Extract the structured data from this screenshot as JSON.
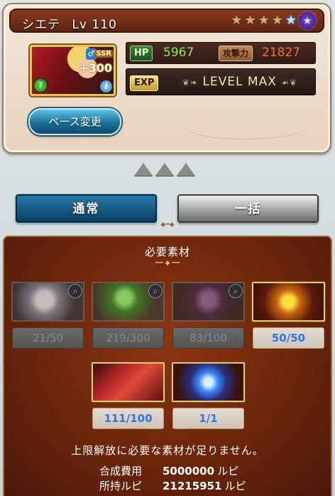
{
  "character": {
    "name": "シエテ",
    "level_label": "Lv",
    "level": "110",
    "rarity": "SSR",
    "plus": "+300",
    "element_icon": "wind-icon",
    "race_icon": "human-icon",
    "stars_total": 6,
    "stars_filled": 6
  },
  "stats": {
    "hp_label": "HP",
    "hp": "5967",
    "atk_label": "攻撃力",
    "atk": "21827",
    "exp_label": "EXP",
    "exp_status": "LEVEL MAX"
  },
  "base_change_label": "ベース変更",
  "tabs": {
    "normal": "通常",
    "bulk": "一括"
  },
  "materials": {
    "title": "必要素材",
    "items": [
      {
        "name": "silver-orb",
        "count": "21/50",
        "state": "dim"
      },
      {
        "name": "green-gem",
        "count": "219/300",
        "state": "dim"
      },
      {
        "name": "dark-tail",
        "count": "83/100",
        "state": "dim"
      },
      {
        "name": "gold-fragment",
        "count": "50/50",
        "state": "ok"
      },
      {
        "name": "red-scroll",
        "count": "111/100",
        "state": "ok"
      },
      {
        "name": "blue-flame",
        "count": "1/1",
        "state": "ok"
      }
    ]
  },
  "status_message": "上限解放に必要な素材が足りません。",
  "cost": {
    "synthesis_label": "合成費用",
    "synthesis_value": "5000000",
    "owned_label": "所持ルピ",
    "owned_value": "21215951",
    "unit": "ルピ"
  },
  "colors": {
    "accent_blue": "#257ba8",
    "hp_green": "#7ff25a",
    "atk_red": "#ff6a3c",
    "count_ok": "#2a78e8"
  }
}
